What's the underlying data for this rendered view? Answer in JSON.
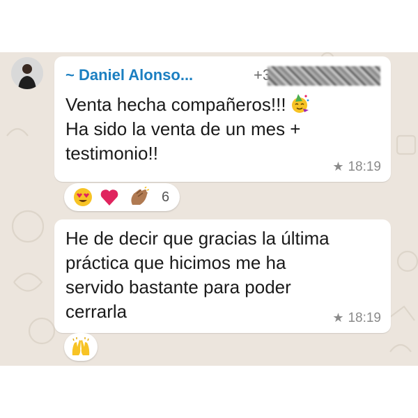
{
  "sender": {
    "name": "~ Daniel Alonso...",
    "phone_prefix": "+3"
  },
  "messages": [
    {
      "lines": [
        "Venta hecha compañeros!!!",
        "Ha sido la venta de un mes +",
        "testimonio!!"
      ],
      "inline_emoji": "partying-face-icon",
      "starred": true,
      "time": "18:19",
      "reactions": [
        "heart-eyes-face-icon",
        "red-heart-icon",
        "clapping-hands-icon"
      ],
      "reaction_count": "6"
    },
    {
      "lines": [
        "He de decir que gracias la última",
        "práctica que hicimos me ha",
        "servido bastante para poder",
        "cerrarla"
      ],
      "starred": true,
      "time": "18:19",
      "reactions": [
        "raising-hands-icon"
      ]
    }
  ],
  "colors": {
    "chat_background": "#ece5dd",
    "sender_name": "#1b7fc1",
    "bubble": "#ffffff",
    "meta_text": "#8a8a8a"
  }
}
